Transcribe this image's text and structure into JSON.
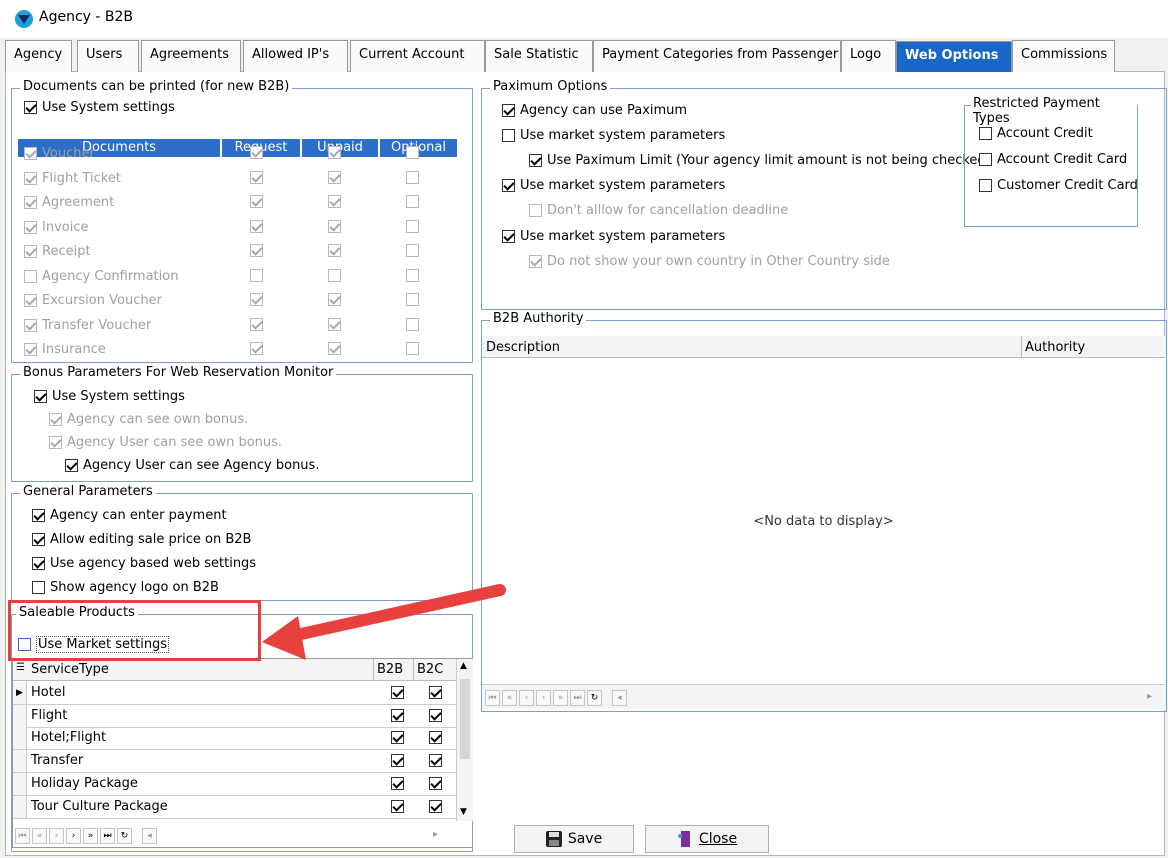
{
  "window": {
    "title": "Agency - B2B"
  },
  "tabs": [
    {
      "label": "Agency"
    },
    {
      "label": "Users"
    },
    {
      "label": "Agreements"
    },
    {
      "label": "Allowed IP's"
    },
    {
      "label": "Current Account"
    },
    {
      "label": "Sale Statistic"
    },
    {
      "label": "Payment Categories from Passenger"
    },
    {
      "label": "Logo"
    },
    {
      "label": "Web Options",
      "active": true
    },
    {
      "label": "Commissions"
    }
  ],
  "documents": {
    "title": "Documents can be printed  (for new B2B)",
    "use_system": {
      "label": "Use System settings",
      "checked": true
    },
    "headers": [
      "Documents",
      "Request",
      "Unpaid",
      "Optional"
    ],
    "rows": [
      {
        "name": "Voucher",
        "checked": true,
        "request": true,
        "unpaid": true,
        "optional": false
      },
      {
        "name": "Flight Ticket",
        "checked": true,
        "request": true,
        "unpaid": true,
        "optional": false
      },
      {
        "name": "Agreement",
        "checked": true,
        "request": true,
        "unpaid": true,
        "optional": false
      },
      {
        "name": "Invoice",
        "checked": true,
        "request": true,
        "unpaid": true,
        "optional": false
      },
      {
        "name": "Receipt",
        "checked": true,
        "request": true,
        "unpaid": true,
        "optional": false
      },
      {
        "name": "Agency Confirmation",
        "checked": false,
        "request": false,
        "unpaid": false,
        "optional": false
      },
      {
        "name": "Excursion Voucher",
        "checked": true,
        "request": true,
        "unpaid": true,
        "optional": false
      },
      {
        "name": "Transfer Voucher",
        "checked": true,
        "request": true,
        "unpaid": true,
        "optional": false
      },
      {
        "name": "Insurance",
        "checked": true,
        "request": true,
        "unpaid": true,
        "optional": false
      }
    ]
  },
  "bonus": {
    "title": "Bonus Parameters For Web Reservation Monitor",
    "use_system": "Use System settings",
    "own_bonus": "Agency can see own bonus.",
    "user_own_bonus": "Agency User can see own bonus.",
    "user_agency_bonus": "Agency User can see Agency bonus."
  },
  "general": {
    "title": "General Parameters",
    "enter_payment": "Agency can enter payment",
    "edit_price": "Allow editing sale price on B2B",
    "web_settings": "Use agency based web settings",
    "show_logo": "Show agency logo on B2B"
  },
  "saleable": {
    "title": "Saleable Products",
    "use_market": "Use Market settings",
    "columns": [
      "ServiceType",
      "B2B",
      "B2C"
    ],
    "rows": [
      {
        "name": "Hotel",
        "b2b": true,
        "b2c": true
      },
      {
        "name": "Flight",
        "b2b": true,
        "b2c": true
      },
      {
        "name": "Hotel;Flight",
        "b2b": true,
        "b2c": true
      },
      {
        "name": "Transfer",
        "b2b": true,
        "b2c": true
      },
      {
        "name": "Holiday Package",
        "b2b": true,
        "b2c": true
      },
      {
        "name": "Tour Culture Package",
        "b2b": true,
        "b2c": true
      }
    ]
  },
  "paximum": {
    "title": "Paximum Options",
    "can_use": "Agency can use Paximum",
    "market1": "Use market system parameters",
    "limit": "Use Paximum Limit  (Your agency limit amount is not being checked)",
    "market2": "Use market system parameters",
    "cancel": "Don't alllow for cancellation deadline",
    "market3": "Use market system parameters",
    "country": "Do not show your own country in Other Country side"
  },
  "restricted": {
    "title": "Restricted Payment Types",
    "items": [
      "Account Credit",
      "Account Credit Card",
      "Customer Credit Card"
    ]
  },
  "authority": {
    "title": "B2B Authority",
    "col_description": "Description",
    "col_authority": "Authority",
    "empty": "<No data to display>"
  },
  "buttons": {
    "save": "Save",
    "close": "Close"
  },
  "colors": {
    "accent": "#1767c8",
    "annotation": "#e8413d"
  }
}
